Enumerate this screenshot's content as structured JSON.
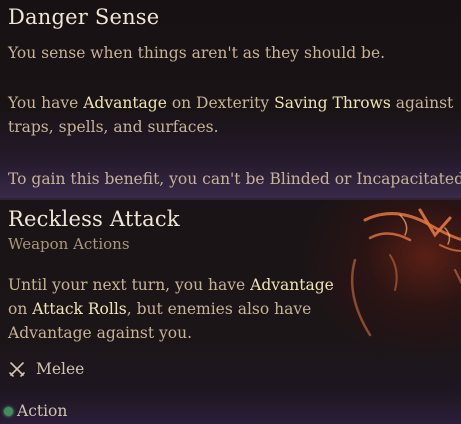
{
  "danger_sense": {
    "title": "Danger Sense",
    "line1": "You sense when things aren't as they should be.",
    "p2_a": "You have ",
    "p2_kw1": "Advantage",
    "p2_b": " on Dexterity ",
    "p2_kw2": "Saving Throws",
    "p2_c": " against",
    "p2_line2": "traps, spells, and surfaces.",
    "condition": "To gain this benefit, you can't be Blinded or Incapacitated."
  },
  "reckless_attack": {
    "title": "Reckless Attack",
    "category": "Weapon Actions",
    "l1_a": "Until your next turn, you have ",
    "l1_kw": "Advantage",
    "l2_a": "on ",
    "l2_kw": "Attack Rolls",
    "l2_b": ", but enemies also have",
    "l3": "Advantage against you.",
    "melee_label": "Melee",
    "action_label": "Action"
  },
  "colors": {
    "keyword": "#f0e4b4",
    "body_text": "#c7b396",
    "action_dot": "#3f8f5a"
  },
  "icons": [
    "crossed-swords-icon",
    "action-dot-icon"
  ]
}
